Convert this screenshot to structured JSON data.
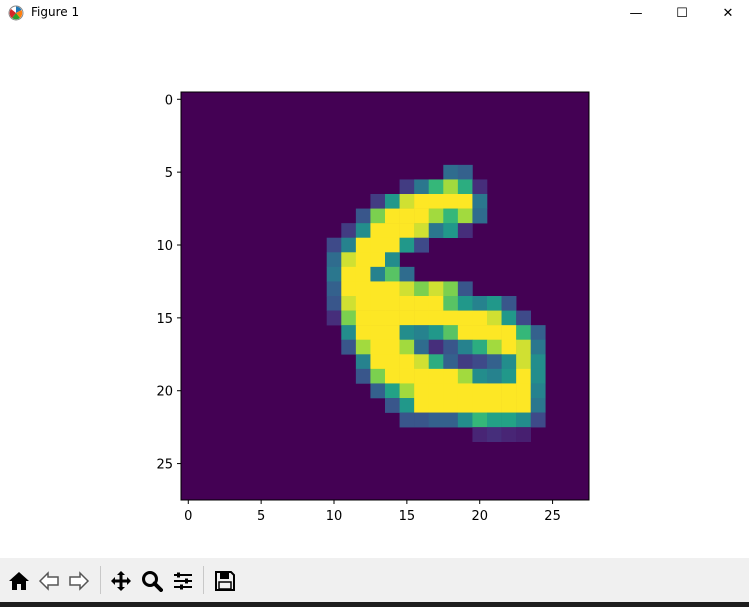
{
  "window": {
    "title": "Figure 1",
    "buttons": [
      "minimize",
      "maximize",
      "close"
    ],
    "minimize_label": "—",
    "maximize_label": "☐",
    "close_label": "✕"
  },
  "toolbar": {
    "items": [
      {
        "name": "home",
        "icon": "home-icon"
      },
      {
        "name": "back",
        "icon": "arrow-left-icon"
      },
      {
        "name": "forward",
        "icon": "arrow-right-icon"
      },
      {
        "name": "pan",
        "icon": "move-icon"
      },
      {
        "name": "zoom",
        "icon": "magnifier-icon"
      },
      {
        "name": "configure-subplots",
        "icon": "sliders-icon"
      },
      {
        "name": "save",
        "icon": "floppy-disk-icon"
      }
    ]
  },
  "chart_data": {
    "type": "heatmap",
    "colormap": "viridis",
    "shape": [
      28,
      28
    ],
    "title": "",
    "xlabel": "",
    "ylabel": "",
    "xlim": [
      -0.5,
      27.5
    ],
    "ylim": [
      27.5,
      -0.5
    ],
    "xticks": [
      0,
      5,
      10,
      15,
      20,
      25
    ],
    "yticks": [
      0,
      5,
      10,
      15,
      20,
      25
    ],
    "xtick_labels": [
      "0",
      "5",
      "10",
      "15",
      "20",
      "25"
    ],
    "ytick_labels": [
      "0",
      "5",
      "10",
      "15",
      "20",
      "25"
    ],
    "grid": false,
    "nonzero_pixels": [
      {
        "row": 5,
        "cols": [
          18,
          19
        ],
        "values": [
          0.4,
          0.35
        ]
      },
      {
        "row": 6,
        "cols": [
          15,
          16,
          17,
          18,
          19,
          20
        ],
        "values": [
          0.2,
          0.45,
          0.75,
          0.9,
          0.7,
          0.15
        ]
      },
      {
        "row": 7,
        "cols": [
          13,
          14,
          15,
          16,
          17,
          18,
          19,
          20
        ],
        "values": [
          0.2,
          0.6,
          0.95,
          1,
          1,
          1,
          1,
          0.45
        ]
      },
      {
        "row": 8,
        "cols": [
          12,
          13,
          14,
          15,
          16,
          17,
          18,
          19,
          20
        ],
        "values": [
          0.3,
          0.85,
          1,
          1,
          1,
          0.9,
          0.75,
          0.9,
          0.4
        ]
      },
      {
        "row": 9,
        "cols": [
          11,
          12,
          13,
          14,
          15,
          16,
          17,
          18,
          19
        ],
        "values": [
          0.2,
          0.55,
          1,
          1,
          1,
          0.95,
          0.45,
          0.6,
          0.15
        ]
      },
      {
        "row": 10,
        "cols": [
          10,
          11,
          12,
          13,
          14,
          15,
          16
        ],
        "values": [
          0.25,
          0.5,
          1,
          1,
          1,
          0.6,
          0.25
        ]
      },
      {
        "row": 11,
        "cols": [
          10,
          11,
          12,
          13,
          14
        ],
        "values": [
          0.4,
          0.95,
          1,
          1,
          0.55
        ]
      },
      {
        "row": 12,
        "cols": [
          10,
          11,
          12,
          13,
          14,
          15
        ],
        "values": [
          0.45,
          1,
          1,
          0.5,
          0.8,
          0.4
        ]
      },
      {
        "row": 13,
        "cols": [
          10,
          11,
          12,
          13,
          14,
          15,
          16,
          17,
          18,
          19
        ],
        "values": [
          0.35,
          1,
          1,
          1,
          1,
          0.95,
          0.85,
          0.95,
          0.85,
          0.3
        ]
      },
      {
        "row": 14,
        "cols": [
          10,
          11,
          12,
          13,
          14,
          15,
          16,
          17,
          18,
          19,
          20,
          21,
          22
        ],
        "values": [
          0.3,
          0.95,
          1,
          1,
          1,
          1,
          1,
          1,
          0.8,
          0.6,
          0.5,
          0.6,
          0.3
        ]
      },
      {
        "row": 15,
        "cols": [
          10,
          11,
          12,
          13,
          14,
          15,
          16,
          17,
          18,
          19,
          20,
          21,
          22,
          23
        ],
        "values": [
          0.15,
          0.85,
          1,
          1,
          1,
          1,
          1,
          1,
          1,
          1,
          1,
          0.95,
          0.6,
          0.25
        ]
      },
      {
        "row": 16,
        "cols": [
          11,
          12,
          13,
          14,
          15,
          16,
          17,
          18,
          19,
          20,
          21,
          22,
          23,
          24
        ],
        "values": [
          0.55,
          1,
          1,
          1,
          0.55,
          0.5,
          0.6,
          0.8,
          1,
          1,
          1,
          1,
          0.75,
          0.35
        ]
      },
      {
        "row": 17,
        "cols": [
          11,
          12,
          13,
          14,
          15,
          16,
          17,
          18,
          19,
          20,
          21,
          22,
          23,
          24
        ],
        "values": [
          0.3,
          0.9,
          1,
          1,
          0.9,
          0.4,
          0.15,
          0.3,
          0.5,
          0.7,
          0.9,
          1,
          0.95,
          0.45
        ]
      },
      {
        "row": 18,
        "cols": [
          12,
          13,
          14,
          15,
          16,
          17,
          18,
          19,
          20,
          21,
          22,
          23,
          24
        ],
        "values": [
          0.5,
          1,
          1,
          1,
          0.95,
          0.7,
          0.35,
          0.2,
          0.25,
          0.35,
          0.55,
          0.95,
          0.55
        ]
      },
      {
        "row": 19,
        "cols": [
          12,
          13,
          14,
          15,
          16,
          17,
          18,
          19,
          20,
          21,
          22,
          23,
          24
        ],
        "values": [
          0.3,
          0.85,
          1,
          1,
          1,
          1,
          1,
          0.9,
          0.55,
          0.5,
          0.6,
          1,
          0.55
        ]
      },
      {
        "row": 20,
        "cols": [
          13,
          14,
          15,
          16,
          17,
          18,
          19,
          20,
          21,
          22,
          23,
          24
        ],
        "values": [
          0.35,
          0.65,
          0.9,
          1,
          1,
          1,
          1,
          1,
          1,
          1,
          1,
          0.5
        ]
      },
      {
        "row": 21,
        "cols": [
          14,
          15,
          16,
          17,
          18,
          19,
          20,
          21,
          22,
          23,
          24
        ],
        "values": [
          0.3,
          0.6,
          1,
          1,
          1,
          1,
          1,
          1,
          1,
          1,
          0.45
        ]
      },
      {
        "row": 22,
        "cols": [
          15,
          16,
          17,
          18,
          19,
          20,
          21,
          22,
          23,
          24
        ],
        "values": [
          0.3,
          0.3,
          0.35,
          0.35,
          0.55,
          0.75,
          0.65,
          0.65,
          0.55,
          0.25
        ]
      },
      {
        "row": 23,
        "cols": [
          20,
          21,
          22,
          23
        ],
        "values": [
          0.12,
          0.15,
          0.12,
          0.1
        ]
      }
    ]
  }
}
